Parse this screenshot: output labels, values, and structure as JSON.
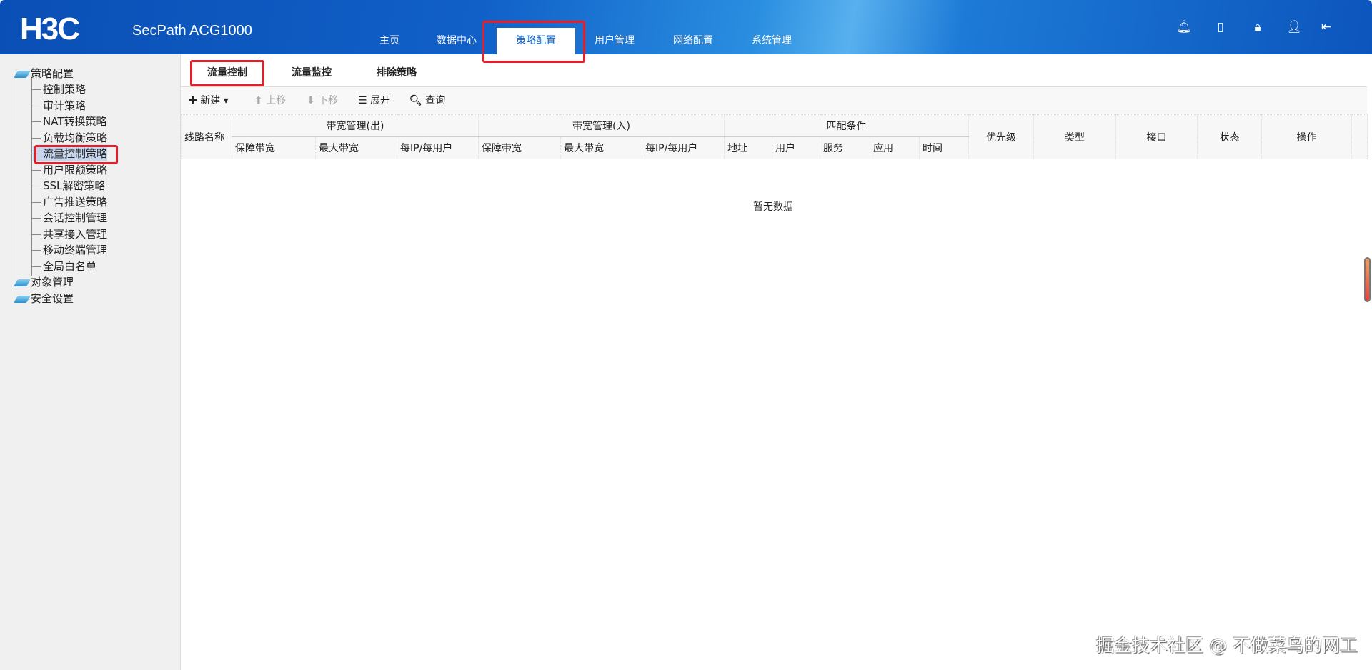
{
  "header": {
    "logo": "H3C",
    "product": "SecPath ACG1000",
    "nav": [
      {
        "label": "主页"
      },
      {
        "label": "数据中心"
      },
      {
        "label": "策略配置",
        "active": true
      },
      {
        "label": "用户管理"
      },
      {
        "label": "网络配置"
      },
      {
        "label": "系统管理"
      }
    ],
    "icons": [
      "bell-icon",
      "save-icon",
      "lock-icon",
      "user-icon",
      "logout-icon"
    ]
  },
  "sidebar": {
    "root": "策略配置",
    "items": [
      "控制策略",
      "审计策略",
      "NAT转换策略",
      "负载均衡策略",
      "流量控制策略",
      "用户限额策略",
      "SSL解密策略",
      "广告推送策略",
      "会话控制管理",
      "共享接入管理",
      "移动终端管理",
      "全局白名单"
    ],
    "selected": "流量控制策略",
    "others": [
      "对象管理",
      "安全设置"
    ]
  },
  "tabs": [
    "流量控制",
    "流量监控",
    "排除策略"
  ],
  "toolbar": {
    "new": "新建",
    "up": "上移",
    "down": "下移",
    "expand": "展开",
    "query": "查询"
  },
  "table": {
    "line_name": "线路名称",
    "bw_out": "带宽管理(出)",
    "bw_in": "带宽管理(入)",
    "match": "匹配条件",
    "bw_sub": [
      "保障带宽",
      "最大带宽",
      "每IP/每用户"
    ],
    "match_sub": [
      "地址",
      "用户",
      "服务",
      "应用",
      "时间"
    ],
    "rest": [
      "优先级",
      "类型",
      "接口",
      "状态",
      "操作"
    ],
    "empty": "暂无数据"
  },
  "watermark": "掘金技术社区 @ 不做菜鸟的网工",
  "colors": {
    "accent": "#1060c8",
    "highlight": "#e0202a"
  }
}
